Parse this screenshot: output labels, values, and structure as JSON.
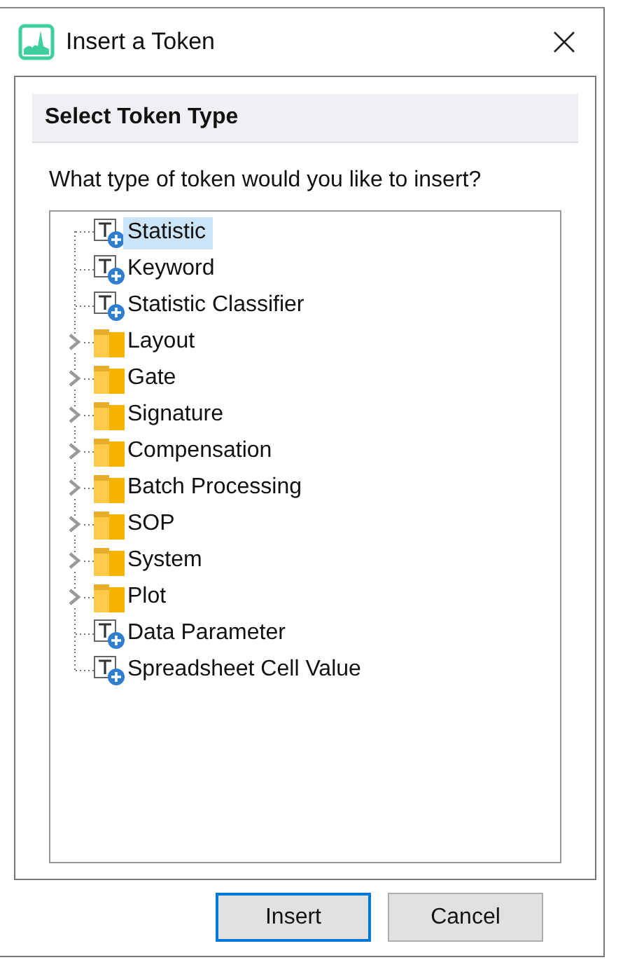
{
  "window": {
    "title": "Insert a Token"
  },
  "section": {
    "heading": "Select Token Type",
    "prompt": "What type of token would you like to insert?"
  },
  "tree": [
    {
      "kind": "token",
      "label": "Statistic",
      "selected": true
    },
    {
      "kind": "token",
      "label": "Keyword",
      "selected": false
    },
    {
      "kind": "token",
      "label": "Statistic Classifier",
      "selected": false
    },
    {
      "kind": "folder",
      "label": "Layout",
      "selected": false,
      "expanded": false
    },
    {
      "kind": "folder",
      "label": "Gate",
      "selected": false,
      "expanded": false
    },
    {
      "kind": "folder",
      "label": "Signature",
      "selected": false,
      "expanded": false
    },
    {
      "kind": "folder",
      "label": "Compensation",
      "selected": false,
      "expanded": false
    },
    {
      "kind": "folder",
      "label": "Batch Processing",
      "selected": false,
      "expanded": false
    },
    {
      "kind": "folder",
      "label": "SOP",
      "selected": false,
      "expanded": false
    },
    {
      "kind": "folder",
      "label": "System",
      "selected": false,
      "expanded": false
    },
    {
      "kind": "folder",
      "label": "Plot",
      "selected": false,
      "expanded": false
    },
    {
      "kind": "token",
      "label": "Data Parameter",
      "selected": false
    },
    {
      "kind": "token",
      "label": "Spreadsheet Cell Value",
      "selected": false
    }
  ],
  "buttons": [
    {
      "label": "Insert",
      "default": true
    },
    {
      "label": "Cancel",
      "default": false
    }
  ]
}
